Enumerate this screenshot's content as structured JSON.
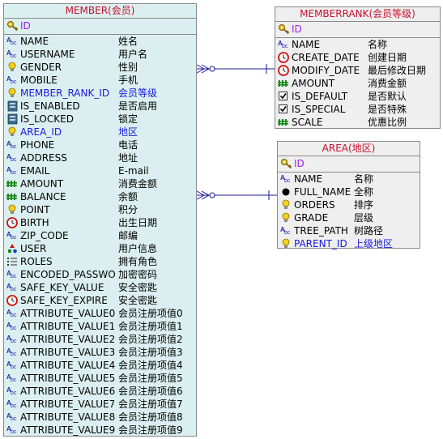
{
  "member": {
    "title": "MEMBER(会员)",
    "pk": {
      "name": "ID",
      "icon": "key-icon"
    },
    "fields": [
      {
        "name": "NAME",
        "cn": "姓名",
        "icon": "abc-icon",
        "fk": false
      },
      {
        "name": "USERNAME",
        "cn": "用户名",
        "icon": "abc-icon",
        "fk": false
      },
      {
        "name": "GENDER",
        "cn": "性别",
        "icon": "bulb-icon",
        "fk": false
      },
      {
        "name": "MOBILE",
        "cn": "手机",
        "icon": "abc-icon",
        "fk": false
      },
      {
        "name": "MEMBER_RANK_ID",
        "cn": "会员等级",
        "icon": "bulb-icon",
        "fk": true
      },
      {
        "name": "IS_ENABLED",
        "cn": "是否启用",
        "icon": "box-icon",
        "fk": false
      },
      {
        "name": "IS_LOCKED",
        "cn": "锁定",
        "icon": "box-icon",
        "fk": false
      },
      {
        "name": "AREA_ID",
        "cn": "地区",
        "icon": "bulb-icon",
        "fk": true
      },
      {
        "name": "PHONE",
        "cn": "电话",
        "icon": "abc-icon",
        "fk": false
      },
      {
        "name": "ADDRESS",
        "cn": "地址",
        "icon": "abc-icon",
        "fk": false
      },
      {
        "name": "EMAIL",
        "cn": "E-mail",
        "icon": "abc-icon",
        "fk": false
      },
      {
        "name": "AMOUNT",
        "cn": "消费金额",
        "icon": "number-icon",
        "fk": false
      },
      {
        "name": "BALANCE",
        "cn": "余额",
        "icon": "number-icon",
        "fk": false
      },
      {
        "name": "POINT",
        "cn": "积分",
        "icon": "bulb-icon",
        "fk": false
      },
      {
        "name": "BIRTH",
        "cn": "出生日期",
        "icon": "clock-icon",
        "fk": false
      },
      {
        "name": "ZIP_CODE",
        "cn": "邮编",
        "icon": "abc-icon",
        "fk": false
      },
      {
        "name": "USER",
        "cn": "用户信息",
        "icon": "shapes-icon",
        "fk": false
      },
      {
        "name": "ROLES",
        "cn": "拥有角色",
        "icon": "list-icon",
        "fk": false
      },
      {
        "name": "ENCODED_PASSWO",
        "cn": "加密密码",
        "icon": "abc-icon",
        "fk": false
      },
      {
        "name": "SAFE_KEY_VALUE",
        "cn": "安全密匙",
        "icon": "abc-icon",
        "fk": false
      },
      {
        "name": "SAFE_KEY_EXPIRE",
        "cn": "安全密匙",
        "icon": "clock-icon",
        "fk": false
      },
      {
        "name": "ATTRIBUTE_VALUE0",
        "cn": "会员注册项值0",
        "icon": "abc-icon",
        "fk": false
      },
      {
        "name": "ATTRIBUTE_VALUE1",
        "cn": "会员注册项值1",
        "icon": "abc-icon",
        "fk": false
      },
      {
        "name": "ATTRIBUTE_VALUE2",
        "cn": "会员注册项值2",
        "icon": "abc-icon",
        "fk": false
      },
      {
        "name": "ATTRIBUTE_VALUE3",
        "cn": "会员注册项值3",
        "icon": "abc-icon",
        "fk": false
      },
      {
        "name": "ATTRIBUTE_VALUE4",
        "cn": "会员注册项值4",
        "icon": "abc-icon",
        "fk": false
      },
      {
        "name": "ATTRIBUTE_VALUE5",
        "cn": "会员注册项值5",
        "icon": "abc-icon",
        "fk": false
      },
      {
        "name": "ATTRIBUTE_VALUE6",
        "cn": "会员注册项值6",
        "icon": "abc-icon",
        "fk": false
      },
      {
        "name": "ATTRIBUTE_VALUE7",
        "cn": "会员注册项值7",
        "icon": "abc-icon",
        "fk": false
      },
      {
        "name": "ATTRIBUTE_VALUE8",
        "cn": "会员注册项值8",
        "icon": "abc-icon",
        "fk": false
      },
      {
        "name": "ATTRIBUTE_VALUE9",
        "cn": "会员注册项值9",
        "icon": "abc-icon",
        "fk": false
      }
    ]
  },
  "memberrank": {
    "title": "MEMBERRANK(会员等级)",
    "pk": {
      "name": "ID",
      "icon": "key-icon"
    },
    "fields": [
      {
        "name": "NAME",
        "cn": "名称",
        "icon": "abc-icon",
        "fk": false
      },
      {
        "name": "CREATE_DATE",
        "cn": "创建日期",
        "icon": "clock-icon",
        "fk": false
      },
      {
        "name": "MODIFY_DATE",
        "cn": "最后修改日期",
        "icon": "clock-icon",
        "fk": false
      },
      {
        "name": "AMOUNT",
        "cn": "消费金额",
        "icon": "number-icon",
        "fk": false
      },
      {
        "name": "IS_DEFAULT",
        "cn": "是否默认",
        "icon": "check-icon",
        "fk": false
      },
      {
        "name": "IS_SPECIAL",
        "cn": "是否特殊",
        "icon": "check-icon",
        "fk": false
      },
      {
        "name": "SCALE",
        "cn": "优惠比例",
        "icon": "number-icon",
        "fk": false
      }
    ]
  },
  "area": {
    "title": "AREA(地区)",
    "pk": {
      "name": "ID",
      "icon": "key-icon"
    },
    "fields": [
      {
        "name": "NAME",
        "cn": "名称",
        "icon": "abc-icon",
        "fk": false
      },
      {
        "name": "FULL_NAME",
        "cn": "全称",
        "icon": "dot-icon",
        "fk": false
      },
      {
        "name": "ORDERS",
        "cn": "排序",
        "icon": "bulb-icon",
        "fk": false
      },
      {
        "name": "GRADE",
        "cn": "层级",
        "icon": "bulb-icon",
        "fk": false
      },
      {
        "name": "TREE_PATH",
        "cn": "树路径",
        "icon": "abc-icon",
        "fk": false
      },
      {
        "name": "PARENT_ID",
        "cn": "上级地区",
        "icon": "bulb-icon",
        "fk": true
      }
    ]
  },
  "colors": {
    "entity_title": "#c8102e",
    "pk_text": "#a020f0",
    "fk_text": "#1a1adf",
    "member_bg": "#dbeff0",
    "table_bg": "#efefef",
    "connector": "#1a1a9a"
  }
}
